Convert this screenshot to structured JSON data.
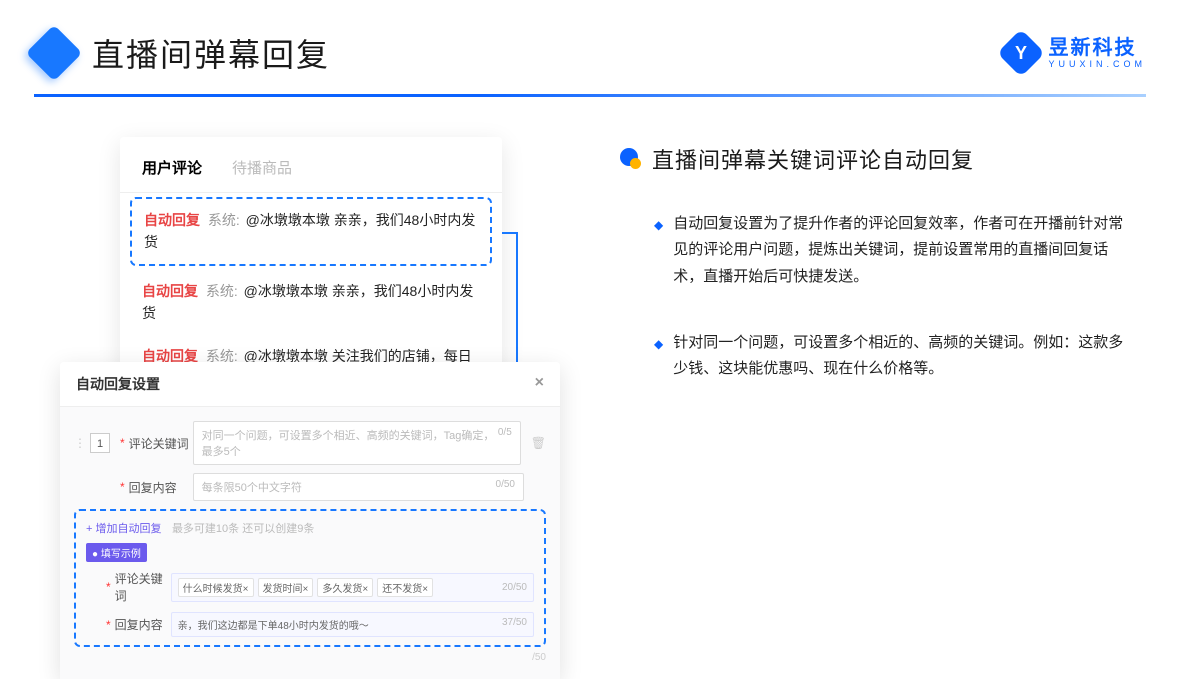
{
  "header": {
    "title": "直播间弹幕回复"
  },
  "brand": {
    "name": "昱新科技",
    "url": "YUUXIN.COM",
    "mark": "Y"
  },
  "comments_card": {
    "tabs": {
      "active": "用户评论",
      "inactive": "待播商品"
    },
    "highlight": {
      "auto": "自动回复",
      "sys": "系统:",
      "text": "@冰墩墩本墩 亲亲，我们48小时内发货"
    },
    "row2": {
      "auto": "自动回复",
      "sys": "系统:",
      "text": "@冰墩墩本墩 亲亲，我们48小时内发货"
    },
    "row3": {
      "auto": "自动回复",
      "sys": "系统:",
      "text": "@冰墩墩本墩 关注我们的店铺，每日都有热门推荐呦～"
    }
  },
  "modal": {
    "title": "自动回复设置",
    "idx": "1",
    "kw_label": "评论关键词",
    "kw_placeholder": "对同一个问题，可设置多个相近、高频的关键词，Tag确定，最多5个",
    "kw_count": "0/5",
    "reply_label": "回复内容",
    "reply_placeholder": "每条限50个中文字符",
    "reply_count": "0/50",
    "add_link": "+ 增加自动回复",
    "add_hint": "最多可建10条 还可以创建9条",
    "example_badge": "● 填写示例",
    "ex_kw_label": "评论关键词",
    "ex_tags": [
      "什么时候发货×",
      "发货时间×",
      "多久发货×",
      "还不发货×"
    ],
    "ex_kw_count": "20/50",
    "ex_reply_label": "回复内容",
    "ex_reply_text": "亲，我们这边都是下单48小时内发货的哦～",
    "ex_reply_count": "37/50",
    "tail_count": "/50"
  },
  "right": {
    "title": "直播间弹幕关键词评论自动回复",
    "p1": "自动回复设置为了提升作者的评论回复效率，作者可在开播前针对常见的评论用户问题，提炼出关键词，提前设置常用的直播间回复话术，直播开始后可快捷发送。",
    "p2": "针对同一个问题，可设置多个相近的、高频的关键词。例如：这款多少钱、这块能优惠吗、现在什么价格等。"
  }
}
